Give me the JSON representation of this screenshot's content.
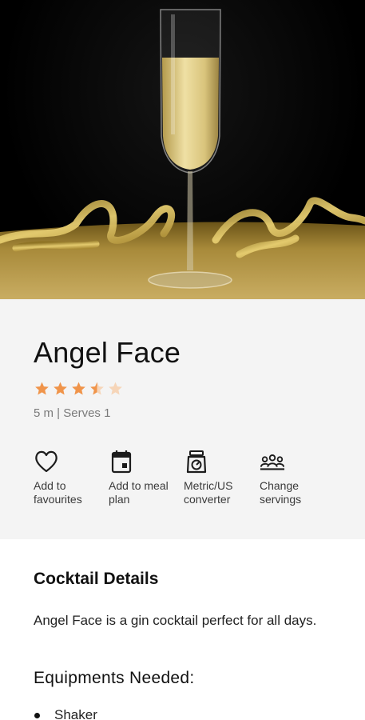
{
  "recipe": {
    "title": "Angel Face",
    "rating": 3.5,
    "rating_max": 5,
    "meta": "5 m | Serves 1"
  },
  "colors": {
    "star_filled": "#f0944a",
    "star_empty": "#f6d5b8",
    "panel_bg": "#f4f4f4"
  },
  "actions": [
    {
      "label": "Add to\nfavourites",
      "icon": "heart-icon"
    },
    {
      "label": "Add to meal\nplan",
      "icon": "calendar-icon"
    },
    {
      "label": "Metric/US\nconverter",
      "icon": "scale-icon"
    },
    {
      "label": "Change\nservings",
      "icon": "people-icon"
    }
  ],
  "details": {
    "section_title": "Cocktail Details",
    "description": "Angel Face is a gin cocktail perfect for all days.",
    "equipment_title": "Equipments Needed:",
    "equipment": [
      "Shaker"
    ]
  }
}
